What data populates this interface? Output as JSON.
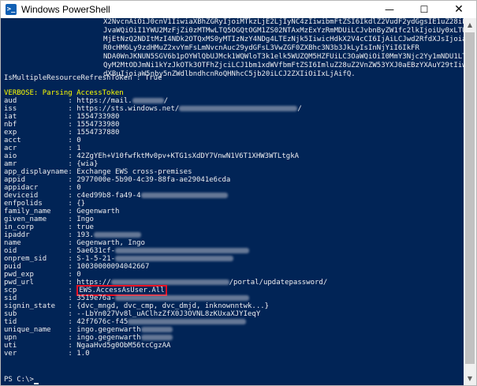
{
  "window": {
    "title": "Windows PowerShell",
    "icon": "powershell-icon",
    "controls": {
      "minimize": "—",
      "maximize": "☐",
      "close": "✕"
    }
  },
  "colors": {
    "console_bg": "#012456",
    "console_fg": "#eeedf0",
    "verbose": "#ffff00",
    "highlight": "#e81123"
  },
  "console": {
    "token_blob": [
      "X2NvcnAiOiJ0cnV1IiwiaXBhZGRyIjoiMTkzLjE2LjIyNC4zIiwibmFtZSI6IkdlZ2VudF2ydGgsIE1uZ28iLC",
      "JvaWQiOiI1YWU2MzFjZi0zMTMwLTQ5OGQtOGM1ZS02NTAxMzExYzRmMDUiLCJvbnByZW1fc2lkIjoiUy0xLTUt",
      "MjEtNzQ2NDItMzI4NDk2OTQxMS0yMTIzNzY4NDg4LTEzNjk5IiwicHdkX2V4cCI6IjAiLCJwd2RfdXJsIjoiaH",
      "R0cHM6Ly9zdHMuZ2xvYmFsLmNvcnAuc29ydGFsL3VwZGF0ZXBhc3N3b3JkLyIsInNjYiI6IkFR",
      "NDA0WnJKNUN5SGV6b1pOYWlQbUJMck1WQWloT3k1elk5WUZQM5HZFUiLC3OaWQiOiI0MmY3Njc2Yy1mNDU1LT",
      "QyM2MtODJmNi1kYzJkOTk3OTFhZjciLCJ1bm1xdWVfbmFtZSI6ImluZ28uZ2VnZW53YXJ0aEBzYXAuY29tIiwi",
      "dXBuIjoiaW5nby5nZWdlbndhcnRoQHNhcC5jb20iLCJ2ZXIiOiIxLjAifQ."
    ],
    "refresh_token_line": "IsMultipleResourceRefreshToken : True",
    "verbose_line": "VERBOSE: Parsing AccessToken",
    "fields": [
      {
        "key": "aud",
        "sep": ":",
        "value": "https://mail.",
        "tail": "/"
      },
      {
        "key": "iss",
        "sep": ":",
        "value": "https://sts.windows.net/",
        "tail": "/"
      },
      {
        "key": "iat",
        "sep": ":",
        "value": "1554733980"
      },
      {
        "key": "nbf",
        "sep": ":",
        "value": "1554733980"
      },
      {
        "key": "exp",
        "sep": ":",
        "value": "1554737880"
      },
      {
        "key": "acct",
        "sep": ":",
        "value": "0"
      },
      {
        "key": "acr",
        "sep": ":",
        "value": "1"
      },
      {
        "key": "aio",
        "sep": ":",
        "value": "42ZgYEh+V10fwfktMv0pv+KTG1sXdDY7VnwN1V6T1XHW3WTLtgkA"
      },
      {
        "key": "amr",
        "sep": ":",
        "value": "{wia}"
      },
      {
        "key": "app_displayname",
        "sep": ":",
        "value": "Exchange EWS cross-premises"
      },
      {
        "key": "appid",
        "sep": ":",
        "value": "2977000e-5b90-4c39-88fa-ae29041e6cda"
      },
      {
        "key": "appidacr",
        "sep": ":",
        "value": "0"
      },
      {
        "key": "deviceid",
        "sep": ":",
        "value": "c4ed99b8-fa49-4"
      },
      {
        "key": "enfpolids",
        "sep": ":",
        "value": "{}"
      },
      {
        "key": "family_name",
        "sep": ":",
        "value": "Gegenwarth"
      },
      {
        "key": "given_name",
        "sep": ":",
        "value": "Ingo"
      },
      {
        "key": "in_corp",
        "sep": ":",
        "value": "true"
      },
      {
        "key": "ipaddr",
        "sep": ":",
        "value": "193."
      },
      {
        "key": "name",
        "sep": ":",
        "value": "Gegenwarth, Ingo"
      },
      {
        "key": "oid",
        "sep": ":",
        "value": "5ae631cf-"
      },
      {
        "key": "onprem_sid",
        "sep": ":",
        "value": "S-1-5-21-"
      },
      {
        "key": "puid",
        "sep": ":",
        "value": "10030000094042667"
      },
      {
        "key": "pwd_exp",
        "sep": ":",
        "value": "0"
      },
      {
        "key": "pwd_url",
        "sep": ":",
        "value": "https://",
        "tail": "/portal/updatepassword/"
      },
      {
        "key": "scp",
        "sep": ":",
        "value": "EWS.AccessAsUser.All"
      },
      {
        "key": "sid",
        "sep": ":",
        "value": "3519e76a-"
      },
      {
        "key": "signin_state",
        "sep": ":",
        "value": "{dvc_mngd, dvc_cmp, dvc_dmjd, inknownntwk...}"
      },
      {
        "key": "sub",
        "sep": ":",
        "value": "--LbYn027Vv8l_uAClhzZfX0J3OVNL8zKUxaXJYIeqY"
      },
      {
        "key": "tid",
        "sep": ":",
        "value": "42f7676c-f45"
      },
      {
        "key": "unique_name",
        "sep": ":",
        "value": "ingo.gegenwarth"
      },
      {
        "key": "upn",
        "sep": ":",
        "value": "ingo.gegenwarth"
      },
      {
        "key": "uti",
        "sep": ":",
        "value": "NgaaHvd5g0ObM56tcCgzAA"
      },
      {
        "key": "ver",
        "sep": ":",
        "value": "1.0"
      }
    ],
    "prompt": "PS C:\\>"
  }
}
